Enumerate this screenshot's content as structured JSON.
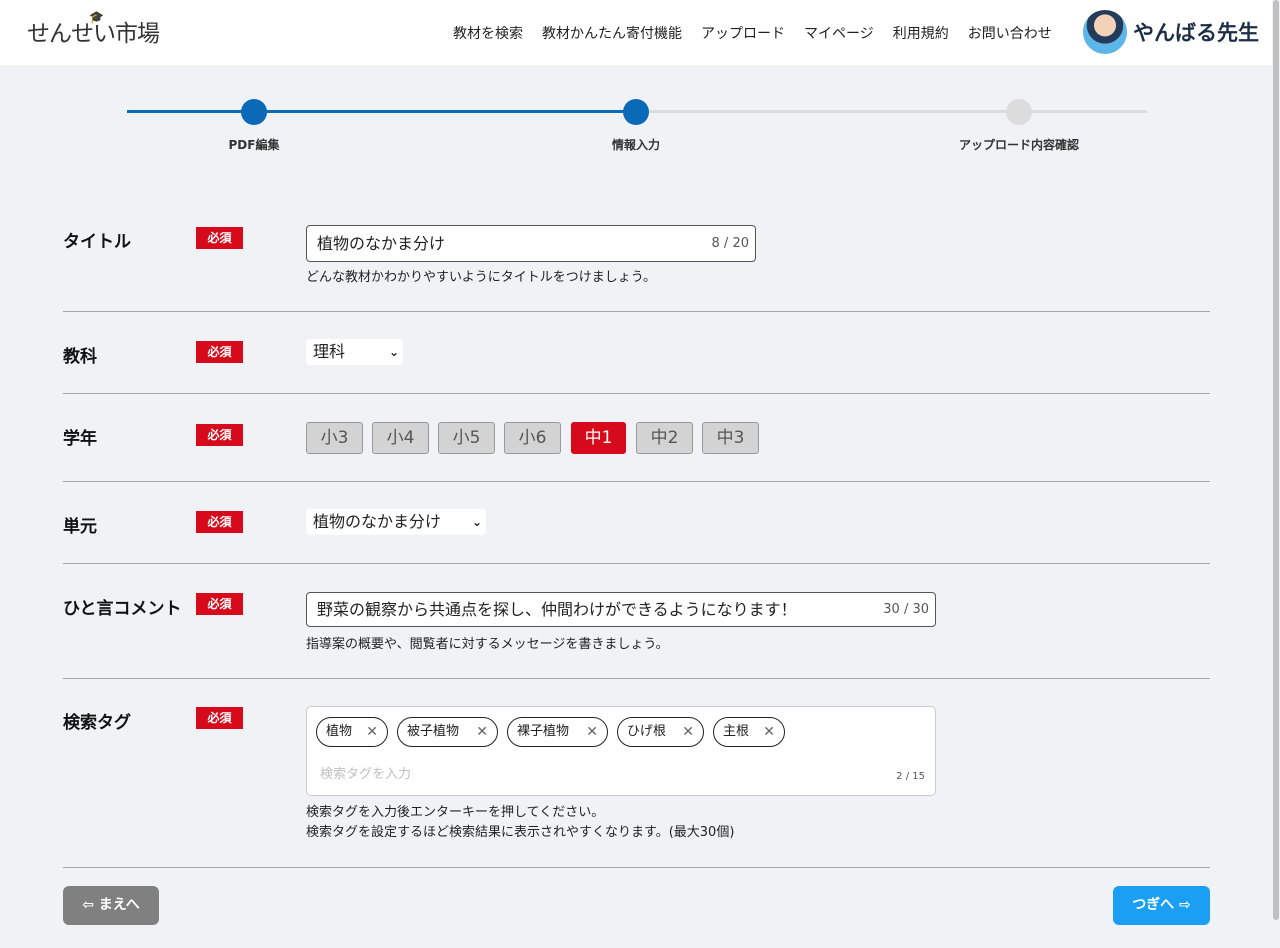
{
  "header": {
    "logo": "せんせい市場",
    "nav": [
      "教材を検索",
      "教材かんたん寄付機能",
      "アップロード",
      "マイページ",
      "利用規約",
      "お問い合わせ"
    ],
    "username": "やんばる先生"
  },
  "stepper": {
    "steps": [
      "PDF編集",
      "情報入力",
      "アップロード内容確認"
    ],
    "current_step": 2
  },
  "required_label": "必須",
  "title_row": {
    "label": "タイトル",
    "value": "植物のなかま分け",
    "counter": "8 / 20",
    "hint": "どんな教材かわかりやすいようにタイトルをつけましょう。"
  },
  "subject_row": {
    "label": "教科",
    "selected": "理科"
  },
  "grade_row": {
    "label": "学年",
    "options": [
      "小3",
      "小4",
      "小5",
      "小6",
      "中1",
      "中2",
      "中3"
    ],
    "selected": "中1"
  },
  "unit_row": {
    "label": "単元",
    "selected": "植物のなかま分け"
  },
  "comment_row": {
    "label": "ひと言コメント",
    "value": "野菜の観察から共通点を探し、仲間わけができるようになります！",
    "counter": "30 / 30",
    "hint": "指導案の概要や、閲覧者に対するメッセージを書きましょう。"
  },
  "tags_row": {
    "label": "検索タグ",
    "tags": [
      "植物",
      "被子植物",
      "裸子植物",
      "ひげ根",
      "主根"
    ],
    "remove_glyph": "✕",
    "placeholder": "検索タグを入力",
    "counter": "2 / 15",
    "hint1": "検索タグを入力後エンターキーを押してください。",
    "hint2": "検索タグを設定するほど検索結果に表示されやすくなります。(最大30個)"
  },
  "buttons": {
    "back": "⇦ まえへ",
    "next": "つぎへ ⇨"
  },
  "colors": {
    "primary": "#0a6ab7",
    "required": "#d60a1a",
    "next_button": "#1a9ff5"
  }
}
